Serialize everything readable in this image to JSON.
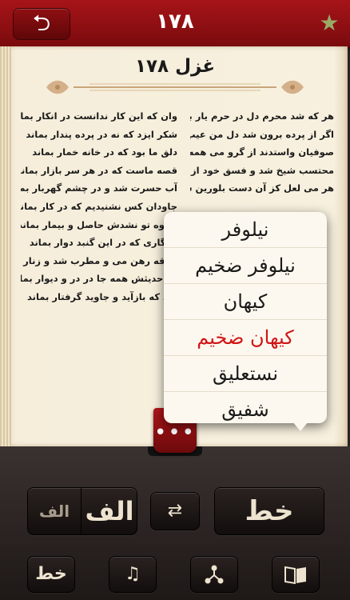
{
  "header": {
    "page_number": "۱۷۸",
    "back_icon": "back-arrow-icon",
    "star_icon": "star-icon"
  },
  "poem": {
    "title": "غزل ۱۷۸",
    "right_column": [
      "هر که شد محرم دل در حرم یار بماند",
      "اگر از پرده برون شد دل من عیب مکن",
      "صوفیان واستدند از گرو می همه رخت",
      "محتسب شیخ شد و فسق خود از یاد ببرد",
      "هر می لعل کز آن دست بلورین ستدیم"
    ],
    "left_column": [
      "وان که این کار ندانست در انکار بماند",
      "شکر ایزد که نه در پرده پندار بماند",
      "دلق ما بود که در خانه خمار بماند",
      "قصه ماست که در هر سر بازار بماند",
      "آب حسرت شد و در چشم گهربار بماند",
      "جاودان کس نشنیدیم که در کار بماند",
      "شیوه تو نشدش حاصل و بیمار بماند",
      "یادگاری که در این گنبد دوار بماند",
      "خرقه رهن می و مطرب شد و زنار بماند",
      "که حدیثش همه جا در در و دیوار بماند",
      "شد که بازآید و جاوید گرفتار بماند"
    ]
  },
  "font_menu": {
    "items": [
      "نیلوفر",
      "نیلوفر ضخیم",
      "کیهان",
      "کیهان ضخیم",
      "نستعلیق",
      "شفیق"
    ],
    "selected_index": 3,
    "selected_color": "#d01515"
  },
  "drawer_handle": {
    "label": "•••"
  },
  "toolbar": {
    "font_size_small": "الف",
    "font_size_large": "الف",
    "swap_icon": "swap-arrows-icon",
    "font_label": "خط",
    "tabs": {
      "font": "خط",
      "music_icon": "music-note-icon",
      "share_icon": "share-icon",
      "book_icon": "book-icon"
    }
  },
  "colors": {
    "accent": "#a61418",
    "paper": "#f7f0de",
    "toolbar": "#2a2220"
  }
}
